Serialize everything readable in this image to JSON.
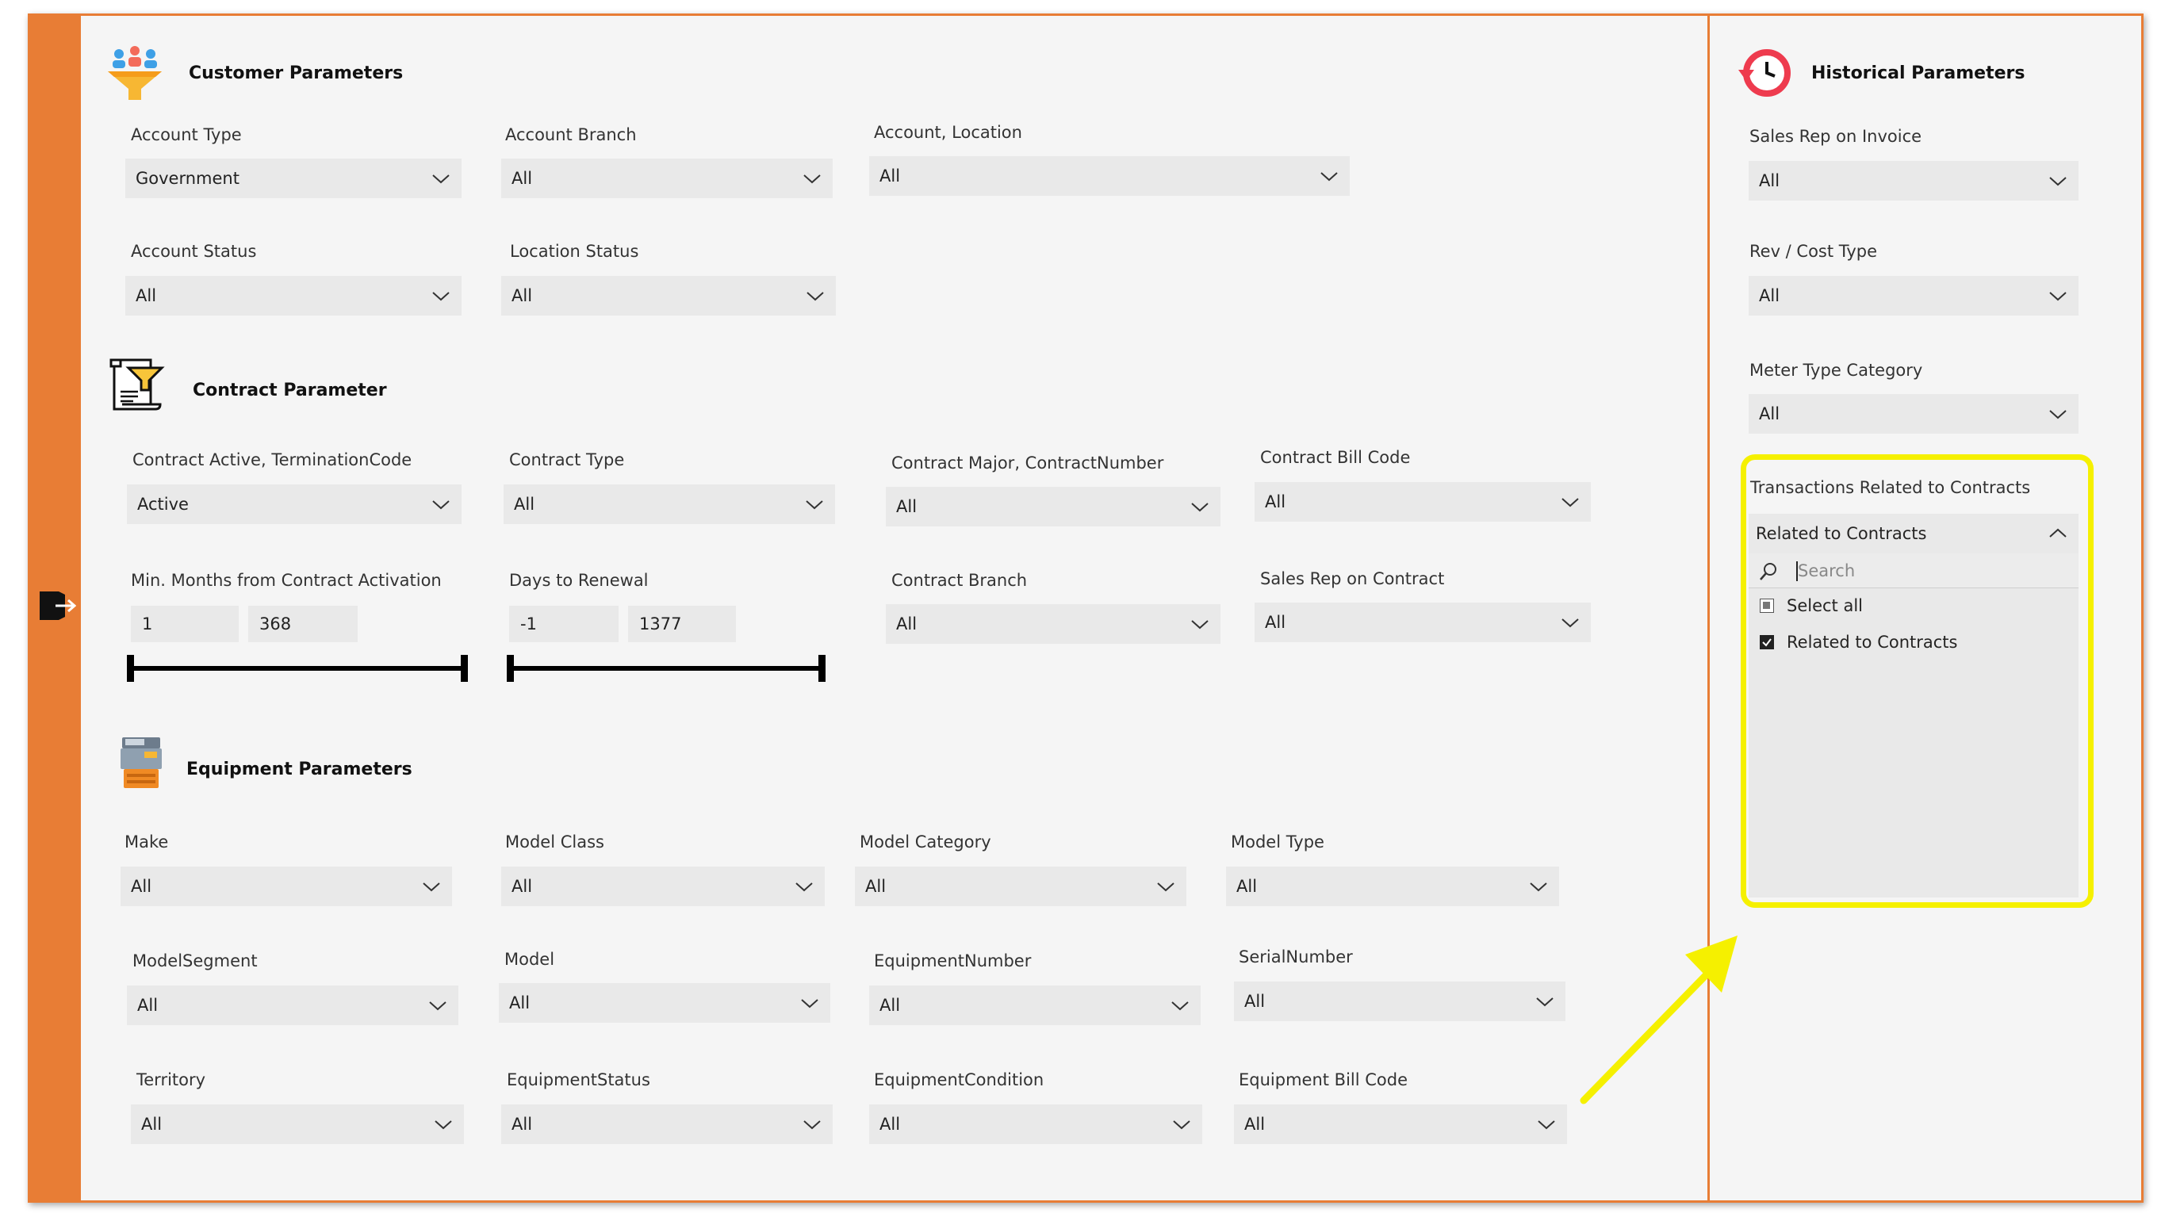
{
  "colors": {
    "accent": "#e87d35",
    "highlight": "#f5f000",
    "dropdown_bg": "#e9e9e9"
  },
  "customer": {
    "title": "Customer Parameters",
    "account_type": {
      "label": "Account Type",
      "value": "Government"
    },
    "account_branch": {
      "label": "Account Branch",
      "value": "All"
    },
    "account_location": {
      "label": "Account, Location",
      "value": "All"
    },
    "account_status": {
      "label": "Account Status",
      "value": "All"
    },
    "location_status": {
      "label": "Location Status",
      "value": "All"
    }
  },
  "contract": {
    "title": "Contract Parameter",
    "active_termination": {
      "label": "Contract Active, TerminationCode",
      "value": "Active"
    },
    "contract_type": {
      "label": "Contract Type",
      "value": "All"
    },
    "major_number": {
      "label": "Contract Major, ContractNumber",
      "value": "All"
    },
    "bill_code": {
      "label": "Contract Bill Code",
      "value": "All"
    },
    "min_months": {
      "label": "Min. Months from Contract Activation",
      "min": "1",
      "max": "368"
    },
    "days_to_renewal": {
      "label": "Days to Renewal",
      "min": "-1",
      "max": "1377"
    },
    "branch": {
      "label": "Contract Branch",
      "value": "All"
    },
    "sales_rep": {
      "label": "Sales Rep on Contract",
      "value": "All"
    }
  },
  "equipment": {
    "title": "Equipment Parameters",
    "make": {
      "label": "Make",
      "value": "All"
    },
    "model_class": {
      "label": "Model Class",
      "value": "All"
    },
    "model_category": {
      "label": "Model Category",
      "value": "All"
    },
    "model_type": {
      "label": "Model Type",
      "value": "All"
    },
    "model_segment": {
      "label": "ModelSegment",
      "value": "All"
    },
    "model": {
      "label": "Model",
      "value": "All"
    },
    "equipment_number": {
      "label": "EquipmentNumber",
      "value": "All"
    },
    "serial_number": {
      "label": "SerialNumber",
      "value": "All"
    },
    "territory": {
      "label": "Territory",
      "value": "All"
    },
    "equipment_status": {
      "label": "EquipmentStatus",
      "value": "All"
    },
    "equipment_condition": {
      "label": "EquipmentCondition",
      "value": "All"
    },
    "equipment_bill_code": {
      "label": "Equipment Bill Code",
      "value": "All"
    }
  },
  "historical": {
    "title": "Historical Parameters",
    "sales_rep_invoice": {
      "label": "Sales Rep on Invoice",
      "value": "All"
    },
    "rev_cost_type": {
      "label": "Rev / Cost Type",
      "value": "All"
    },
    "meter_type_category": {
      "label": "Meter Type Category",
      "value": "All"
    },
    "transactions": {
      "label": "Transactions Related to Contracts",
      "value": "Related to Contracts",
      "search_placeholder": "Search",
      "options": [
        "Select all",
        "Related to Contracts"
      ]
    }
  }
}
